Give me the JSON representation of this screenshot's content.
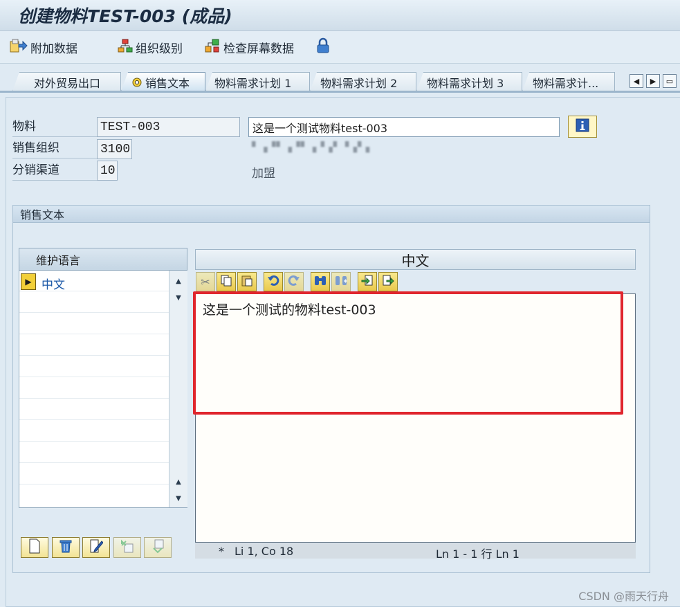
{
  "window": {
    "title": "创建物料TEST-003 (成品)"
  },
  "toolbar": {
    "additional_data": "附加数据",
    "org_levels": "组织级别",
    "check_screen_data": "检查屏幕数据"
  },
  "tabs": [
    {
      "label": "对外贸易出口"
    },
    {
      "label": "销售文本"
    },
    {
      "label": "物料需求计划 1"
    },
    {
      "label": "物料需求计划 2"
    },
    {
      "label": "物料需求计划 3"
    },
    {
      "label": "物料需求计..."
    }
  ],
  "header_fields": {
    "material_label": "物料",
    "material_value": "TEST-003",
    "material_desc": "这是一个测试物料test-003",
    "sales_org_label": "销售组织",
    "sales_org_value": "3100",
    "distribution_channel_label": "分销渠道",
    "distribution_channel_value": "10",
    "distribution_channel_desc": "加盟"
  },
  "sales_text": {
    "group_title": "销售文本",
    "language_table": {
      "header": "维护语言",
      "rows": [
        {
          "label": "中文"
        }
      ]
    },
    "editor_language": "中文",
    "editor_content": "这是一个测试的物料test-003",
    "status": {
      "modified_flag": "*",
      "position": "Li 1, Co 18",
      "lines": "Ln 1 - 1 行 Ln 1"
    }
  },
  "watermark": "CSDN @雨天行舟",
  "colors": {
    "highlight": "#e0262d",
    "link_blue": "#1d5aa8",
    "marker_yellow": "#f2cf38"
  }
}
